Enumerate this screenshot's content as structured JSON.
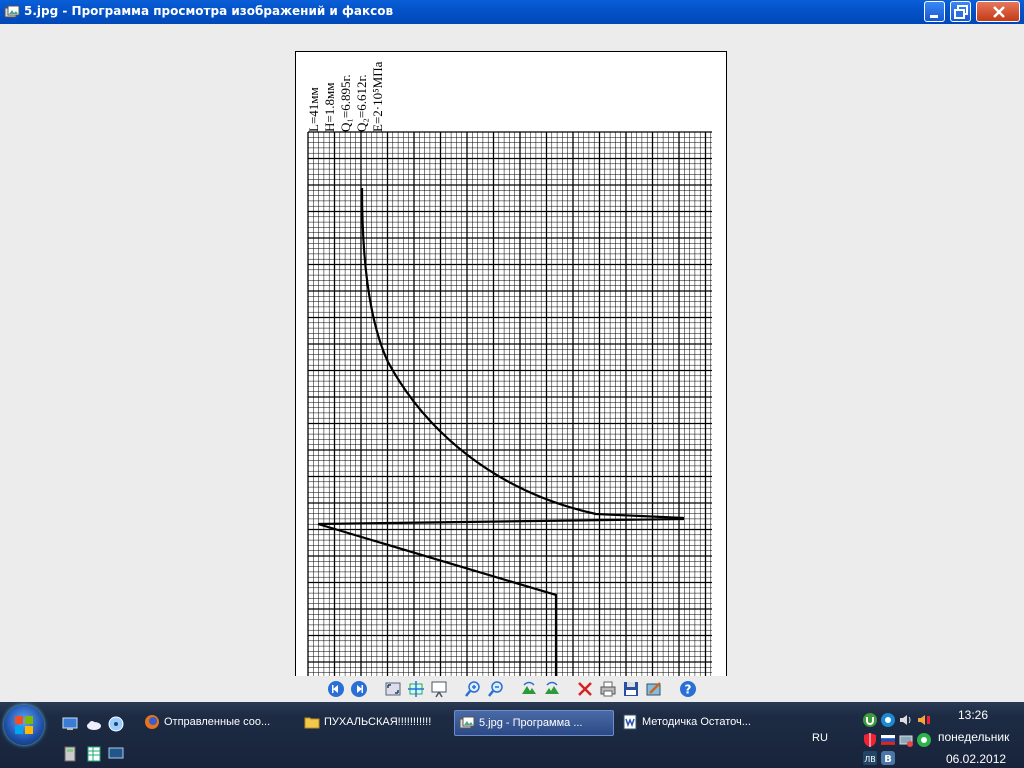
{
  "window": {
    "title": "5.jpg - Программа просмотра изображений и факсов"
  },
  "image": {
    "annotations": [
      "L=41мм",
      "H=1.8мм",
      "Q₁=6.895г.",
      "Q₂=6.612г.",
      "E=2·10⁵МПа"
    ]
  },
  "toolbar": {
    "buttons": [
      "previous-image",
      "next-image",
      "best-fit",
      "actual-size",
      "slideshow",
      "zoom-in",
      "zoom-out",
      "rotate-clockwise",
      "rotate-counterclockwise",
      "delete",
      "print",
      "copy-to",
      "edit",
      "help"
    ]
  },
  "taskbar": {
    "tasks": [
      {
        "label": "Отправленные соо...",
        "icon": "firefox-icon"
      },
      {
        "label": "ПУХАЛЬСКАЯ!!!!!!!!!!!",
        "icon": "folder-icon"
      },
      {
        "label": "5.jpg - Программа ...",
        "icon": "image-viewer-icon",
        "active": true
      },
      {
        "label": "Методичка Остаточ...",
        "icon": "word-document-icon"
      }
    ],
    "language": "RU",
    "clock": {
      "time": "13:26",
      "day": "понедельник",
      "date": "06.02.2012"
    }
  },
  "colors": {
    "titlebar": "#0453c9",
    "taskbar": "#1d2b44",
    "close": "#c43b16"
  }
}
